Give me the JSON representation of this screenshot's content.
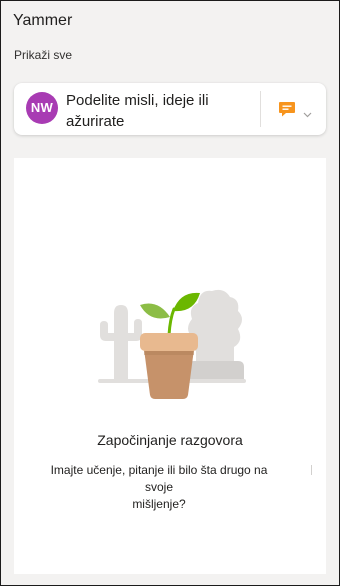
{
  "app": {
    "title": "Yammer"
  },
  "feed": {
    "show_all_label": "Prikaži sve"
  },
  "composer": {
    "avatar_initials": "NW",
    "avatar_color": "#a83bb3",
    "prompt": "Podelite misli, ideje ili ažurirate",
    "type_icon": "message-bubble-icon",
    "type_icon_color": "#f7941d",
    "dropdown_icon": "chevron-down-icon"
  },
  "empty_state": {
    "illustration": "plant-pot-illustration",
    "title": "Započinjanje razgovora",
    "body_line1": "Imajte učenje, pitanje ili bilo šta drugo na",
    "body_line2": "svoje",
    "body_line3": "mišljenje?"
  }
}
